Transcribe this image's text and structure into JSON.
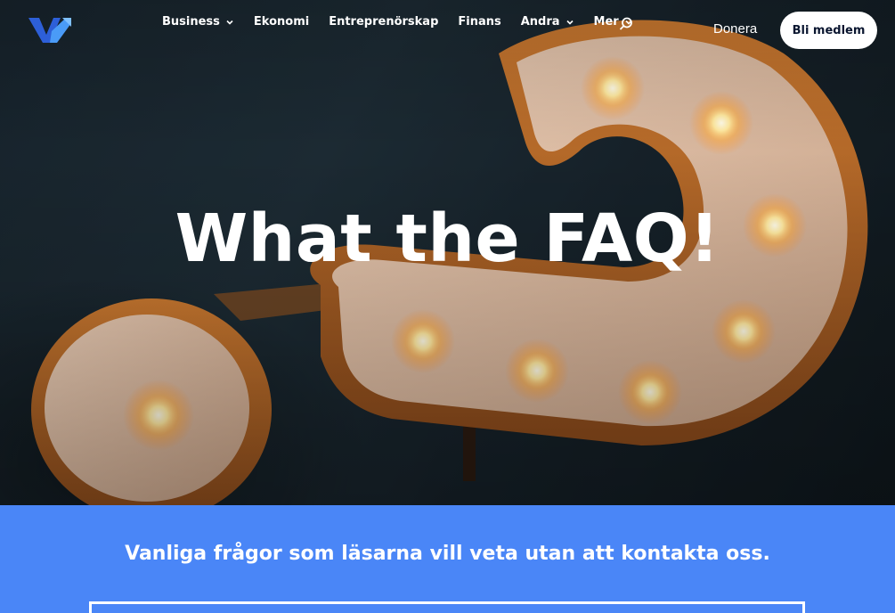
{
  "nav": {
    "logo": "brand-logo",
    "items": [
      {
        "label": "Business",
        "has_dropdown": true
      },
      {
        "label": "Ekonomi",
        "has_dropdown": false
      },
      {
        "label": "Entreprenörskap",
        "has_dropdown": false
      },
      {
        "label": "Finans",
        "has_dropdown": false
      },
      {
        "label": "Andra",
        "has_dropdown": true
      },
      {
        "label": "Mer",
        "has_dropdown": true
      }
    ],
    "search_icon": "search-icon",
    "donate_label": "Donera",
    "member_button_label": "Bli medlem"
  },
  "hero": {
    "title": "What the FAQ!",
    "image": "marquee-question-mark-lights"
  },
  "intro": {
    "text": "Vanliga frågor som läsarna vill veta utan att kontakta oss."
  },
  "colors": {
    "accent_blue": "#4a86f7",
    "logo_blue": "#2d6ff0",
    "white": "#ffffff"
  }
}
